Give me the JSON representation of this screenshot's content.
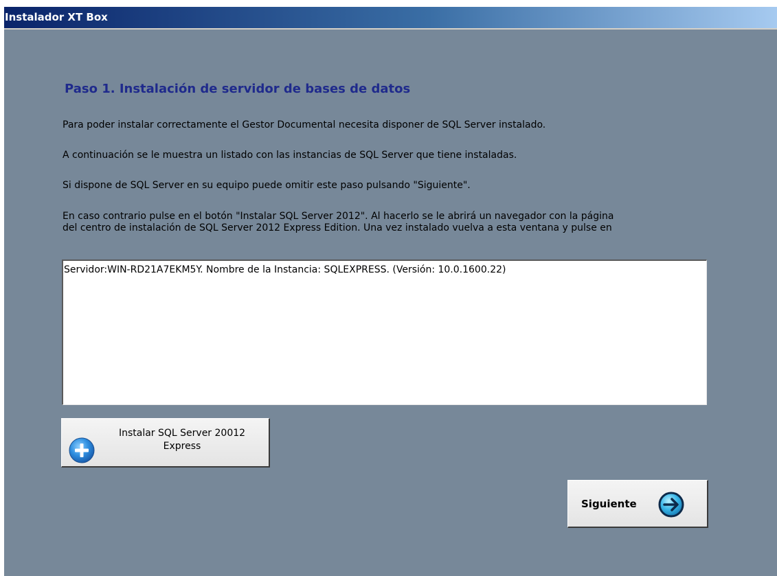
{
  "window": {
    "title": "Instalador XT Box"
  },
  "step": {
    "heading": "Paso 1. Instalación de servidor de bases de datos",
    "paragraphs": [
      "Para poder instalar correctamente el Gestor Documental necesita disponer de SQL Server instalado.",
      "A continuación se le muestra un listado con las instancias de SQL Server que tiene instaladas.",
      "Si dispone de SQL Server en su equipo puede omitir este paso pulsando \"Siguiente\".",
      "En caso contrario pulse en el botón \"Instalar SQL Server 2012\". Al hacerlo se le abrirá un navegador con la página",
      "del centro de instalación de SQL Server 2012 Express Edition. Una vez instalado vuelva a esta ventana y pulse en"
    ]
  },
  "instances": {
    "items": [
      "Servidor:WIN-RD21A7EKM5Y. Nombre de la Instancia: SQLEXPRESS. (Versión: 10.0.1600.22)"
    ]
  },
  "buttons": {
    "install": {
      "label_line1": "Instalar SQL Server 20012",
      "label_line2": "Express",
      "icon": "plus-circle-icon"
    },
    "next": {
      "label": "Siguiente",
      "icon": "arrow-right-circle-icon"
    }
  },
  "colors": {
    "window_background": "#778899",
    "heading": "#1f2a8c",
    "titlebar_start": "#0a246a",
    "titlebar_end": "#a6caf0"
  }
}
